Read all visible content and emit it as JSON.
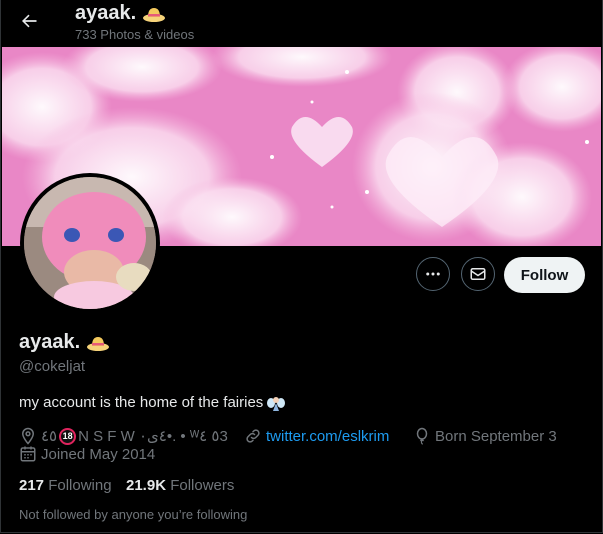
{
  "header": {
    "title": "ayaak.",
    "subtitle": "733 Photos & videos"
  },
  "profile": {
    "name": "ayaak.",
    "handle": "@cokeljat",
    "bio": "my account is the home of the fairies",
    "location_prefix": "٤٥",
    "location_badge": "18",
    "location_rest": "N S F W ٤ى٠•. • ᵂ٥ ٤3",
    "website": "twitter.com/eslkrim",
    "born": "Born September 3",
    "joined": "Joined May 2014",
    "following_count": "217",
    "following_label": "Following",
    "followers_count": "21.9K",
    "followers_label": "Followers",
    "not_followed_note": "Not followed by anyone you’re following"
  },
  "actions": {
    "follow_label": "Follow"
  },
  "colors": {
    "accent": "#1d9bf0",
    "banner_pink": "#e987c6",
    "muted": "#71767b"
  }
}
